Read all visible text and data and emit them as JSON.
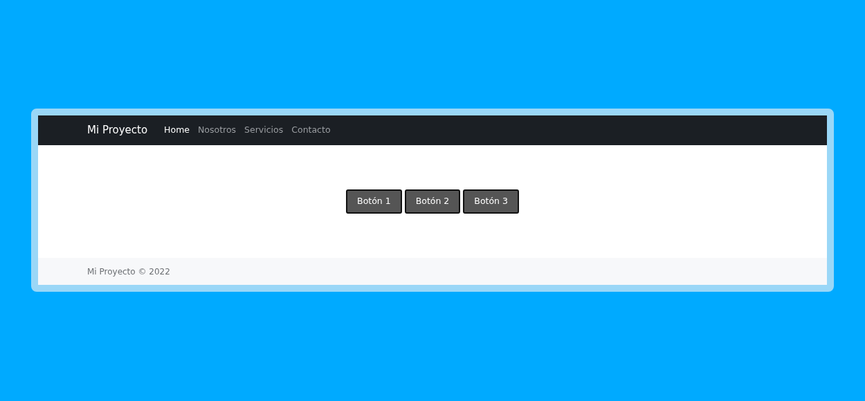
{
  "navbar": {
    "brand": "Mi Proyecto",
    "links": [
      {
        "label": "Home",
        "selected": true
      },
      {
        "label": "Nosotros",
        "selected": false
      },
      {
        "label": "Servicios",
        "selected": false
      },
      {
        "label": "Contacto",
        "selected": false
      }
    ]
  },
  "buttons": [
    "Botón 1",
    "Botón 2",
    "Botón 3"
  ],
  "footer": {
    "text": "Mi Proyecto © 2022"
  }
}
